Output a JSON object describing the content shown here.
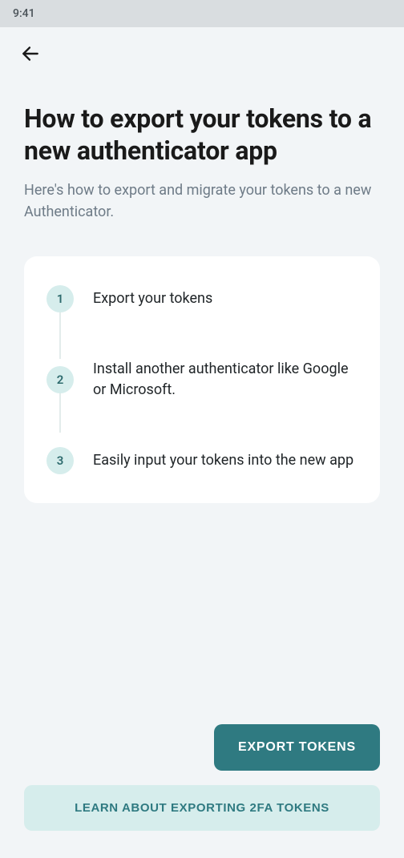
{
  "status": {
    "time": "9:41"
  },
  "page": {
    "title": "How to export your tokens to a new authenticator app",
    "subtitle": "Here's how to export and migrate your tokens to a new Authenticator."
  },
  "steps": [
    {
      "num": "1",
      "text": "Export your tokens"
    },
    {
      "num": "2",
      "text": "Install another authenticator like Google or Microsoft."
    },
    {
      "num": "3",
      "text": "Easily input your tokens into the new app"
    }
  ],
  "actions": {
    "primary": "EXPORT TOKENS",
    "secondary": "LEARN ABOUT EXPORTING 2FA TOKENS"
  },
  "colors": {
    "accent": "#2f7a81",
    "accentLight": "#d6edec"
  }
}
